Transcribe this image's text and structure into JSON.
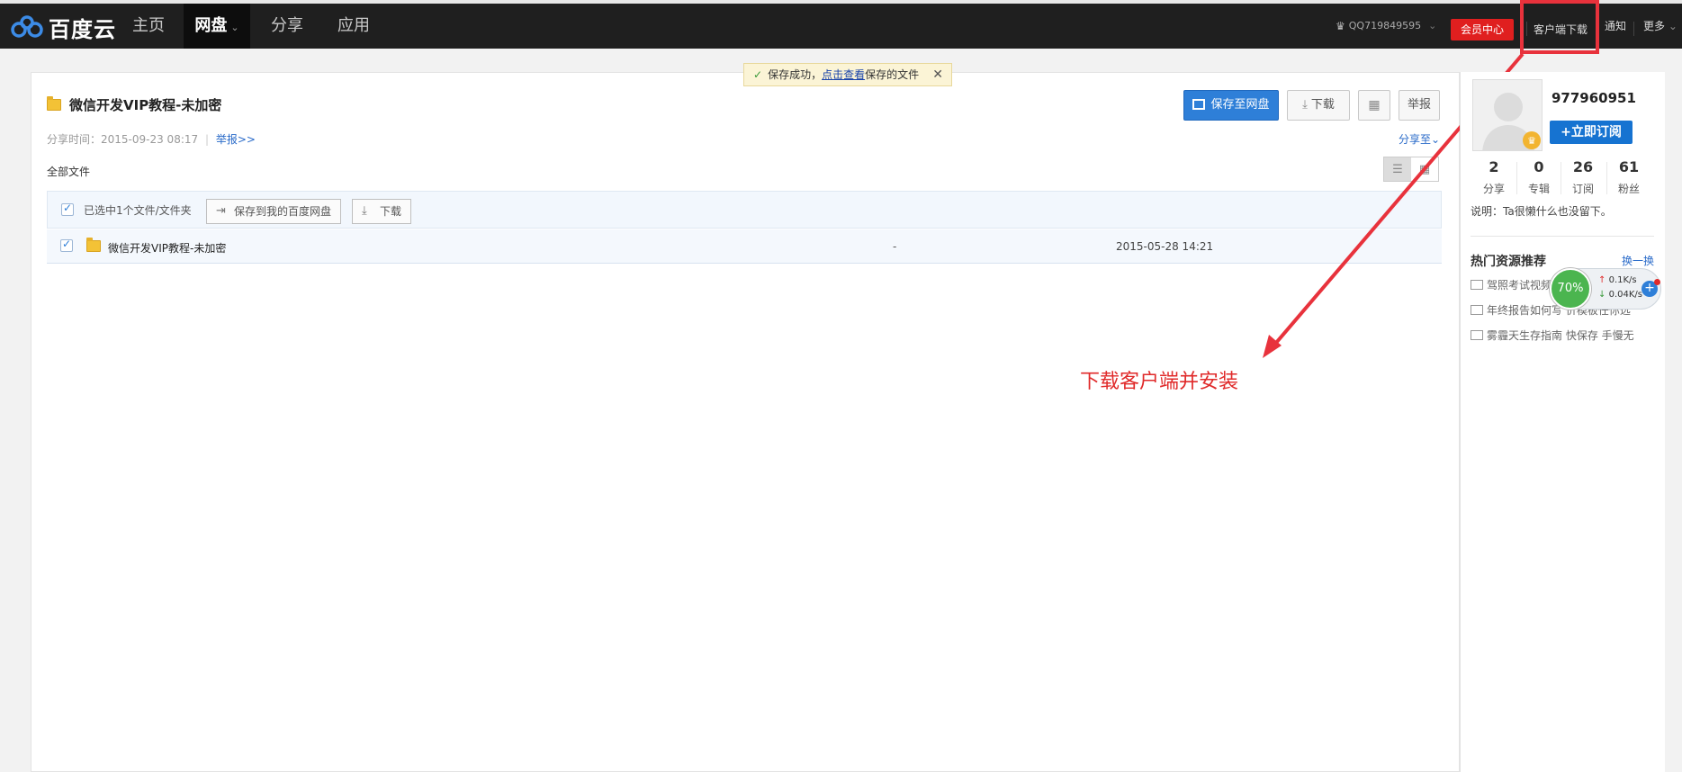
{
  "topbar": {
    "logo_text": "百度云",
    "nav": [
      {
        "label": "主页"
      },
      {
        "label": "网盘"
      },
      {
        "label": "分享"
      },
      {
        "label": "应用"
      }
    ],
    "username": "QQ719849595",
    "vip_center": "会员中心",
    "client_download": "客户端下载",
    "notify": "通知",
    "more": "更多"
  },
  "toast": {
    "prefix": "保存成功，",
    "link": "点击查看",
    "suffix": "保存的文件"
  },
  "share": {
    "title": "微信开发VIP教程-未加密",
    "share_time": "分享时间：2015-09-23 08:17",
    "report_link": "举报>>",
    "all_files": "全部文件",
    "save_button": "保存至网盘",
    "download_button": "下载",
    "report_button": "举报",
    "share_to": "分享至"
  },
  "selection": {
    "label": "已选中1个文件/文件夹",
    "save_button": "保存到我的百度网盘",
    "download_button": "下载"
  },
  "files": [
    {
      "name": "微信开发VIP教程-未加密",
      "size": "-",
      "date": "2015-05-28 14:21"
    }
  ],
  "annotation": "下载客户端并安装",
  "sidebar": {
    "user_id": "977960951",
    "subscribe_button": "立即订阅",
    "stats": [
      {
        "value": "2",
        "label": "分享"
      },
      {
        "value": "0",
        "label": "专辑"
      },
      {
        "value": "26",
        "label": "订阅"
      },
      {
        "value": "61",
        "label": "粉丝"
      }
    ],
    "intro": "说明：Ta很懒什么也没留下。",
    "hot_title": "热门资源推荐",
    "hot_swap": "换一换",
    "hot_items": [
      {
        "text": "驾照考试视频"
      },
      {
        "text": "年终报告如何写 价模板任你选"
      },
      {
        "text": "雾霾天生存指南  快保存  手慢无"
      }
    ]
  },
  "speed_widget": {
    "percent": "70%",
    "up": "0.1K/s",
    "down": "0.04K/s"
  },
  "colors": {
    "topbar": "#1f1f1f",
    "accent_blue": "#2e7fd8",
    "vip_red": "#e01f1f",
    "annotation_red": "#e02a2a"
  }
}
